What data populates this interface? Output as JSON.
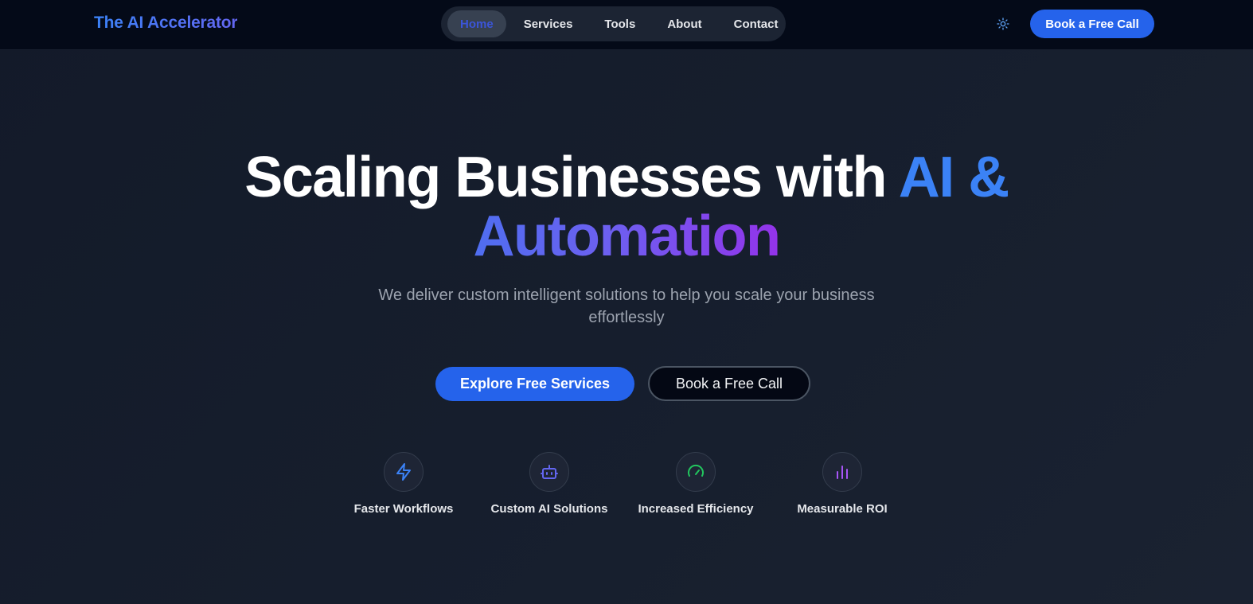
{
  "header": {
    "brand": "The AI Accelerator",
    "nav": [
      {
        "label": "Home",
        "active": true
      },
      {
        "label": "Services"
      },
      {
        "label": "Tools"
      },
      {
        "label": "About"
      },
      {
        "label": "Contact"
      }
    ],
    "theme_icon": "sun-icon",
    "cta_label": "Book a Free Call"
  },
  "hero": {
    "title_part1": "Scaling Businesses with ",
    "title_accent1": "AI &",
    "title_accent2": "Automation",
    "subtitle": "We deliver custom intelligent solutions to help you scale your business effortlessly",
    "primary_button": "Explore Free Services",
    "secondary_button": "Book a Free Call"
  },
  "features": [
    {
      "label": "Faster Workflows",
      "icon": "lightning-icon",
      "color": "#3b82f6"
    },
    {
      "label": "Custom AI Solutions",
      "icon": "robot-icon",
      "color": "#6366f1"
    },
    {
      "label": "Increased Efficiency",
      "icon": "gauge-icon",
      "color": "#22c55e"
    },
    {
      "label": "Measurable ROI",
      "icon": "bar-chart-icon",
      "color": "#a855f7"
    }
  ],
  "colors": {
    "accent": "#2563eb",
    "background": "#161e2d",
    "header": "#040a18"
  }
}
